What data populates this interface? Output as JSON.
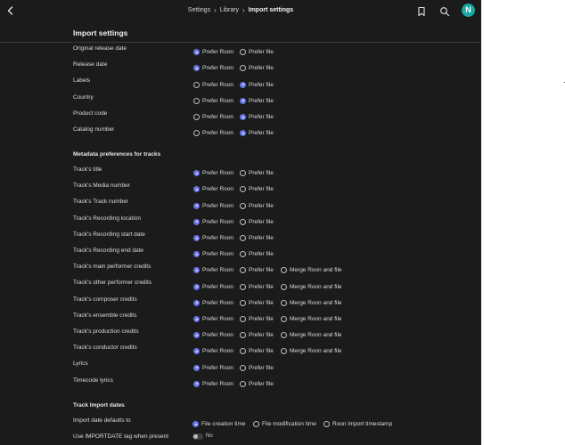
{
  "breadcrumb": {
    "items": [
      "Settings",
      "Library"
    ],
    "current": "Import settings"
  },
  "header": {
    "avatar_letter": "N"
  },
  "section_title": "Import settings",
  "album_rows": [
    {
      "label": "Original release date",
      "options": [
        "Prefer Roon",
        "Prefer file"
      ],
      "selected": 0
    },
    {
      "label": "Release date",
      "options": [
        "Prefer Roon",
        "Prefer file"
      ],
      "selected": 0
    },
    {
      "label": "Labels",
      "options": [
        "Prefer Roon",
        "Prefer file"
      ],
      "selected": 1
    },
    {
      "label": "Country",
      "options": [
        "Prefer Roon",
        "Prefer file"
      ],
      "selected": 1
    },
    {
      "label": "Product code",
      "options": [
        "Prefer Roon",
        "Prefer file"
      ],
      "selected": 1
    },
    {
      "label": "Catalog number",
      "options": [
        "Prefer Roon",
        "Prefer file"
      ],
      "selected": 1
    }
  ],
  "tracks_group_title": "Metadata preferences for tracks",
  "track_rows": [
    {
      "label": "Track's title",
      "options": [
        "Prefer Roon",
        "Prefer file"
      ],
      "selected": 0
    },
    {
      "label": "Track's Media number",
      "options": [
        "Prefer Roon",
        "Prefer file"
      ],
      "selected": 0
    },
    {
      "label": "Track's Track number",
      "options": [
        "Prefer Roon",
        "Prefer file"
      ],
      "selected": 0
    },
    {
      "label": "Track's Recording location",
      "options": [
        "Prefer Roon",
        "Prefer file"
      ],
      "selected": 0
    },
    {
      "label": "Track's Recording start date",
      "options": [
        "Prefer Roon",
        "Prefer file"
      ],
      "selected": 0
    },
    {
      "label": "Track's Recording end date",
      "options": [
        "Prefer Roon",
        "Prefer file"
      ],
      "selected": 0
    },
    {
      "label": "Track's main performer credits",
      "options": [
        "Prefer Roon",
        "Prefer file",
        "Merge Roon and file"
      ],
      "selected": 0
    },
    {
      "label": "Track's other performer credits",
      "options": [
        "Prefer Roon",
        "Prefer file",
        "Merge Roon and file"
      ],
      "selected": 0
    },
    {
      "label": "Track's composer credits",
      "options": [
        "Prefer Roon",
        "Prefer file",
        "Merge Roon and file"
      ],
      "selected": 0
    },
    {
      "label": "Track's ensemble credits",
      "options": [
        "Prefer Roon",
        "Prefer file",
        "Merge Roon and file"
      ],
      "selected": 0
    },
    {
      "label": "Track's production credits",
      "options": [
        "Prefer Roon",
        "Prefer file",
        "Merge Roon and file"
      ],
      "selected": 0
    },
    {
      "label": "Track's conductor credits",
      "options": [
        "Prefer Roon",
        "Prefer file",
        "Merge Roon and file"
      ],
      "selected": 0
    },
    {
      "label": "Lyrics",
      "options": [
        "Prefer Roon",
        "Prefer file"
      ],
      "selected": 0
    },
    {
      "label": "Timecode lyrics",
      "options": [
        "Prefer Roon",
        "Prefer file"
      ],
      "selected": 0
    }
  ],
  "import_dates_group_title": "Track Import dates",
  "import_date_row": {
    "label": "Import date defaults to",
    "options": [
      "File creation time",
      "File modification time",
      "Roon import timestamp"
    ],
    "selected": 0
  },
  "importdate_tag_row": {
    "label": "Use IMPORTDATE tag when present",
    "value": "No"
  },
  "colors": {
    "background": "#1b1b1c",
    "accent": "#6b75e8",
    "avatar": "#1aa6a2"
  },
  "icons": {
    "back": "chevron-left-icon",
    "bookmark": "bookmark-icon",
    "search": "search-icon",
    "breadcrumb_separator": "chevron-right-icon"
  }
}
